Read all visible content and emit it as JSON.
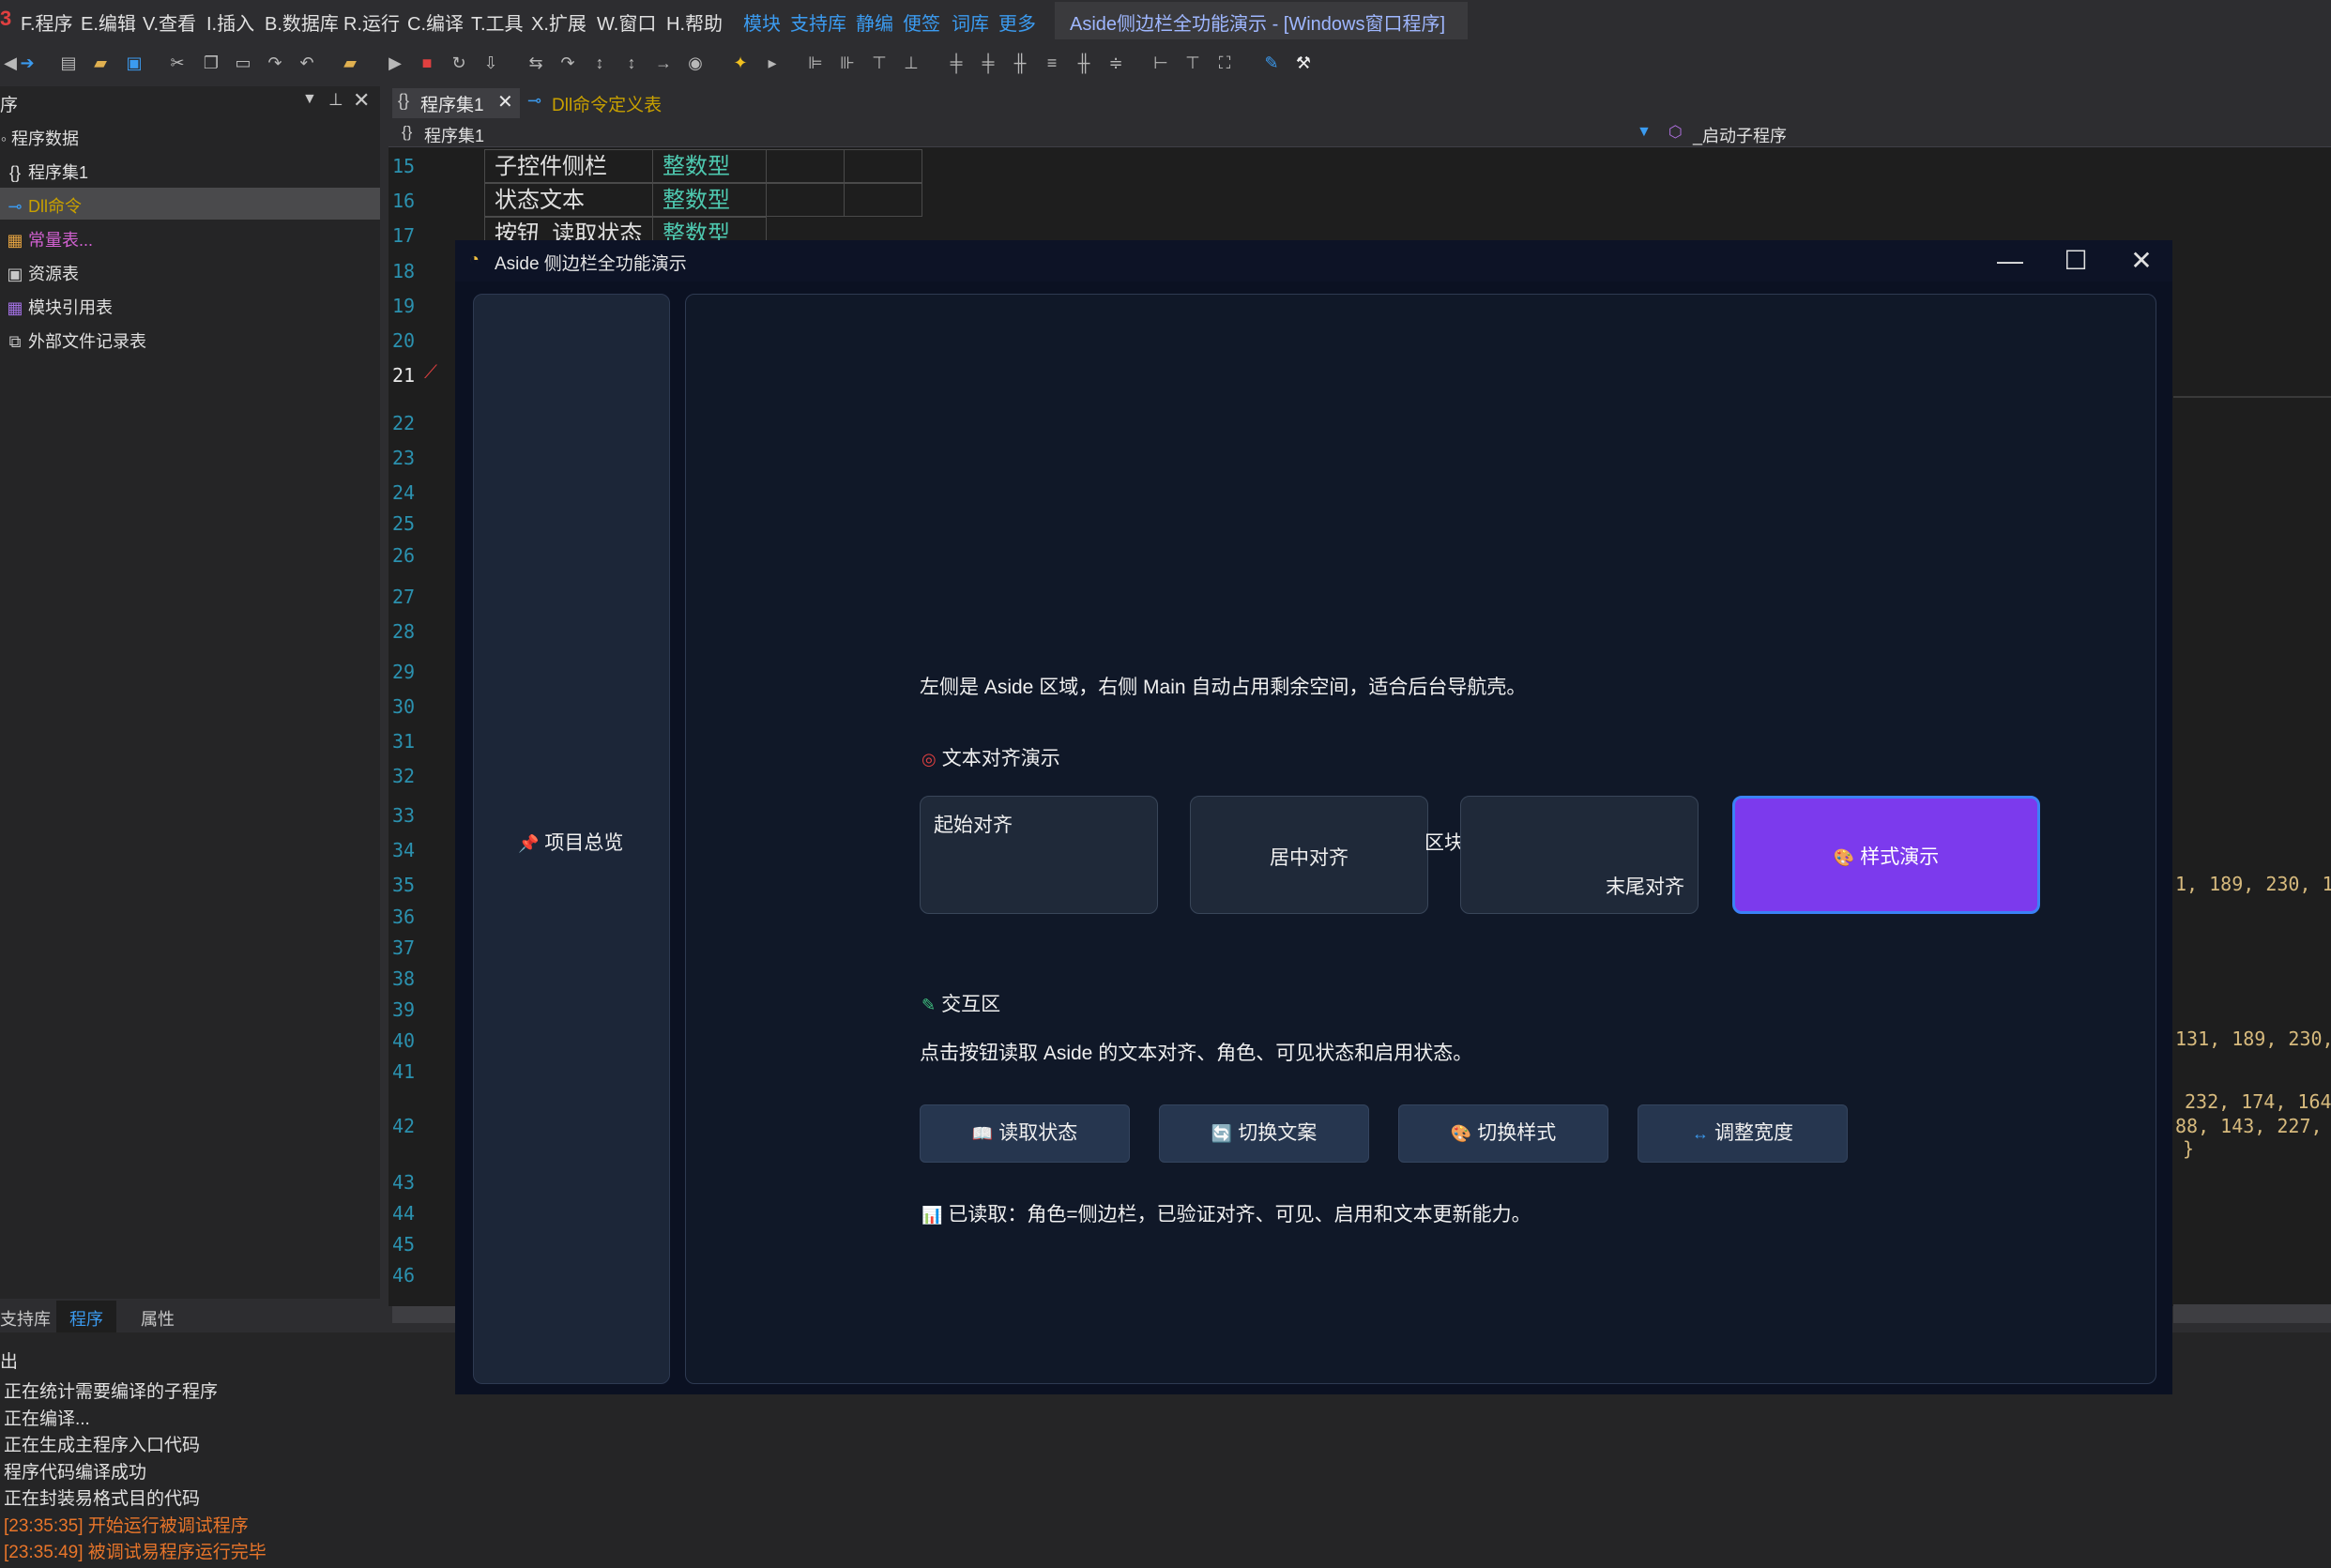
{
  "menu": {
    "items": [
      "F.程序",
      "E.编辑",
      "V.查看",
      "I.插入",
      "B.数据库",
      "R.运行",
      "C.编译",
      "T.工具",
      "X.扩展",
      "W.窗口",
      "H.帮助"
    ],
    "links": [
      "模块",
      "支持库",
      "静编",
      "便签",
      "词库",
      "更多"
    ],
    "window_title": "Aside侧边栏全功能演示 - [Windows窗口程序]"
  },
  "left_panel": {
    "header": "序",
    "items": [
      "程序数据",
      "程序集1",
      "Dll命令",
      "常量表...",
      "资源表",
      "模块引用表",
      "外部文件记录表"
    ],
    "tabs": [
      "支持库",
      "程序",
      "属性"
    ]
  },
  "editor": {
    "tab_active": "程序集1",
    "tab_second": "Dll命令定义表",
    "nav_left": "程序集1",
    "nav_right": "_启动子程序",
    "line_numbers": [
      "15",
      "16",
      "17",
      "18",
      "19",
      "20",
      "21",
      "22",
      "23",
      "24",
      "25",
      "26",
      "27",
      "28",
      "29",
      "30",
      "31",
      "32",
      "33",
      "34",
      "35",
      "36",
      "37",
      "38",
      "39",
      "40",
      "41",
      "42",
      "43",
      "44",
      "45",
      "46"
    ],
    "table": [
      {
        "name": "子控件侧栏",
        "type": "整数型"
      },
      {
        "name": "状态文本",
        "type": "整数型"
      },
      {
        "name": "按钮_读取状态",
        "type": "整数型"
      }
    ],
    "code_fragments": [
      "1, 189, 230, 1",
      "131, 189, 230,",
      "232, 174, 164",
      "88, 143, 227,",
      "}"
    ]
  },
  "output": {
    "header": "出",
    "lines": [
      "正在统计需要编译的子程序",
      "正在编译...",
      "正在生成主程序入口代码",
      "程序代码编译成功",
      "正在封装易格式目的代码"
    ],
    "run_lines": [
      "[23:35:35] 开始运行被调试程序",
      "[23:35:49] 被调试易程序运行完毕"
    ]
  },
  "window": {
    "title": "Aside 侧边栏全功能演示",
    "aside_label": "项目总览",
    "intro": "左侧是 Aside 区域，右侧 Main 自动占用剩余空间，适合后台导航壳。",
    "align_heading": "文本对齐演示",
    "align_boxes": [
      "起始对齐",
      "居中对齐",
      "末尾对齐"
    ],
    "overlap_text": "区块",
    "style_button": "样式演示",
    "interact_heading": "交互区",
    "interact_desc": "点击按钮读取 Aside 的文本对齐、角色、可见状态和启用状态。",
    "buttons": [
      "读取状态",
      "切换文案",
      "切换样式",
      "调整宽度"
    ],
    "result": "已读取：角色=侧边栏，已验证对齐、可见、启用和文本更新能力。"
  },
  "colors": {
    "accent_purple": "#7c3aed",
    "accent_blue_border": "#3b82f6",
    "window_bg": "#0b1122",
    "output_run": "#e8752a"
  }
}
